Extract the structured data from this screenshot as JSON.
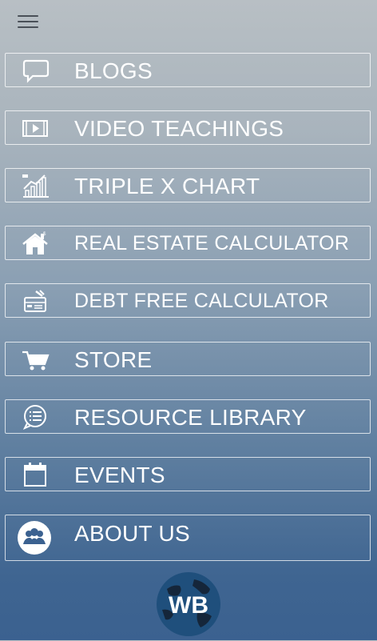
{
  "header": {
    "menu_icon": "hamburger-menu-icon"
  },
  "menu": {
    "items": [
      {
        "label": "BLOGS",
        "icon": "chat-bubble-icon"
      },
      {
        "label": "VIDEO TEACHINGS",
        "icon": "video-player-icon"
      },
      {
        "label": "TRIPLE X CHART",
        "icon": "growth-chart-icon"
      },
      {
        "label": "REAL ESTATE CALCULATOR",
        "icon": "house-icon"
      },
      {
        "label": "DEBT FREE CALCULATOR",
        "icon": "credit-card-icon"
      },
      {
        "label": "STORE",
        "icon": "shopping-cart-icon"
      },
      {
        "label": "RESOURCE LIBRARY",
        "icon": "list-bubble-icon"
      },
      {
        "label": "EVENTS",
        "icon": "calendar-icon"
      },
      {
        "label": "ABOUT US",
        "icon": "people-icon"
      }
    ]
  },
  "logo": {
    "text": "WB",
    "icon": "globe-logo"
  },
  "colors": {
    "text": "#ffffff",
    "border": "#ffffff",
    "accent": "#3b6190"
  }
}
